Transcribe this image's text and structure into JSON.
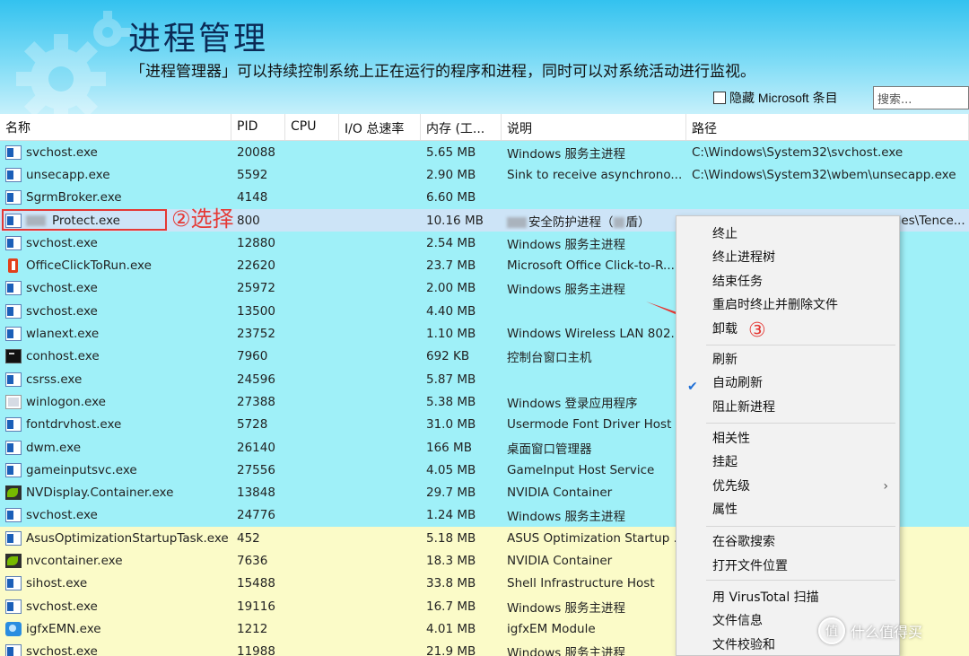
{
  "header": {
    "title": "进程管理",
    "subtitle": "「进程管理器」可以持续控制系统上正在运行的程序和进程，同时可以对系统活动进行监视。",
    "hide_ms_label": "隐藏 Microsoft 条目",
    "search_placeholder": "搜索..."
  },
  "columns": [
    "名称",
    "PID",
    "CPU",
    "I/O 总速率",
    "内存 (工...",
    "说明",
    "路径"
  ],
  "rows": [
    {
      "name": "svchost.exe",
      "pid": "20088",
      "mem": "5.65 MB",
      "desc": "Windows 服务主进程",
      "path": "C:\\Windows\\System32\\svchost.exe",
      "icon": "exe"
    },
    {
      "name": "unsecapp.exe",
      "pid": "5592",
      "mem": "2.90 MB",
      "desc": "Sink to receive asynchrono...",
      "path": "C:\\Windows\\System32\\wbem\\unsecapp.exe",
      "icon": "exe"
    },
    {
      "name": "SgrmBroker.exe",
      "pid": "4148",
      "mem": "6.60 MB",
      "desc": "",
      "path": "",
      "icon": "exe"
    },
    {
      "name": "Protect.exe",
      "pid": "800",
      "mem": "10.16 MB",
      "desc": "安全防护进程（",
      "desc_tail": "盾）",
      "path": "C:\\Program Files (x86)\\Common Files\\Tence...",
      "icon": "exe"
    },
    {
      "name": "svchost.exe",
      "pid": "12880",
      "mem": "2.54 MB",
      "desc": "Windows 服务主进程",
      "path": "",
      "icon": "exe"
    },
    {
      "name": "OfficeClickToRun.exe",
      "pid": "22620",
      "mem": "23.7 MB",
      "desc": "Microsoft Office Click-to-R...",
      "path": "rosoft s...",
      "icon": "office"
    },
    {
      "name": "svchost.exe",
      "pid": "25972",
      "mem": "2.00 MB",
      "desc": "Windows 服务主进程",
      "path": "",
      "icon": "exe"
    },
    {
      "name": "svchost.exe",
      "pid": "13500",
      "mem": "4.40 MB",
      "desc": "",
      "path": "",
      "icon": "exe"
    },
    {
      "name": "wlanext.exe",
      "pid": "23752",
      "mem": "1.10 MB",
      "desc": "Windows Wireless LAN 802....",
      "path": "",
      "icon": "exe"
    },
    {
      "name": "conhost.exe",
      "pid": "7960",
      "mem": "692 KB",
      "desc": "控制台窗口主机",
      "path": "",
      "icon": "console"
    },
    {
      "name": "csrss.exe",
      "pid": "24596",
      "mem": "5.87 MB",
      "desc": "",
      "path": "",
      "icon": "exe"
    },
    {
      "name": "winlogon.exe",
      "pid": "27388",
      "mem": "5.38 MB",
      "desc": "Windows 登录应用程序",
      "path": "e",
      "icon": "logon"
    },
    {
      "name": "fontdrvhost.exe",
      "pid": "5728",
      "mem": "31.0 MB",
      "desc": "Usermode Font Driver Host",
      "path": "exe",
      "icon": "exe"
    },
    {
      "name": "dwm.exe",
      "pid": "26140",
      "mem": "166 MB",
      "desc": "桌面窗口管理器",
      "path": "",
      "icon": "exe"
    },
    {
      "name": "gameinputsvc.exe",
      "pid": "27556",
      "mem": "4.05 MB",
      "desc": "GameInput Host Service",
      "path": "meInput...",
      "icon": "exe"
    },
    {
      "name": "NVDisplay.Container.exe",
      "pid": "13848",
      "mem": "29.7 MB",
      "desc": "NVIDIA Container",
      "path": "ileRepo...",
      "icon": "nvidia"
    },
    {
      "name": "svchost.exe",
      "pid": "24776",
      "mem": "1.24 MB",
      "desc": "Windows 服务主进程",
      "path": "",
      "icon": "exe"
    },
    {
      "name": "AsusOptimizationStartupTask.exe",
      "pid": "452",
      "mem": "5.18 MB",
      "desc": "ASUS Optimization Startup ...",
      "path": "ileRepo...",
      "icon": "exe"
    },
    {
      "name": "nvcontainer.exe",
      "pid": "7636",
      "mem": "18.3 MB",
      "desc": "NVIDIA Container",
      "path": "n\\NvCo...",
      "icon": "nvidia"
    },
    {
      "name": "sihost.exe",
      "pid": "15488",
      "mem": "33.8 MB",
      "desc": "Shell Infrastructure Host",
      "path": "",
      "icon": "exe"
    },
    {
      "name": "svchost.exe",
      "pid": "19116",
      "mem": "16.7 MB",
      "desc": "Windows 服务主进程",
      "path": "",
      "icon": "exe"
    },
    {
      "name": "igfxEMN.exe",
      "pid": "1212",
      "mem": "4.01 MB",
      "desc": "igfxEM Module",
      "path": "",
      "icon": "igfx"
    },
    {
      "name": "svchost.exe",
      "pid": "11988",
      "mem": "21.9 MB",
      "desc": "Windows 服务主进程",
      "path": "",
      "icon": "exe"
    }
  ],
  "row_colors": [
    "cyan",
    "cyan",
    "cyan",
    "selected",
    "cyan",
    "cyan",
    "cyan",
    "cyan",
    "cyan",
    "cyan",
    "cyan",
    "cyan",
    "cyan",
    "cyan",
    "cyan",
    "cyan",
    "cyan",
    "yellow",
    "yellow",
    "yellow",
    "yellow",
    "yellow",
    "yellow"
  ],
  "annotations": {
    "step2": "②选择",
    "step3": "③"
  },
  "context_menu": {
    "items": [
      {
        "label": "终止"
      },
      {
        "label": "终止进程树"
      },
      {
        "label": "结束任务"
      },
      {
        "label": "重启时终止并删除文件"
      },
      {
        "label": "卸载"
      },
      {
        "label": "刷新"
      },
      {
        "label": "自动刷新",
        "checked": true
      },
      {
        "label": "阻止新进程"
      },
      {
        "label": "相关性"
      },
      {
        "label": "挂起"
      },
      {
        "label": "优先级",
        "submenu": true
      },
      {
        "label": "属性"
      },
      {
        "label": "在谷歌搜索"
      },
      {
        "label": "打开文件位置"
      },
      {
        "label": "用 VirusTotal 扫描"
      },
      {
        "label": "文件信息"
      },
      {
        "label": "文件校验和"
      }
    ]
  },
  "watermark": {
    "logo": "值",
    "text": "什么值得买"
  },
  "colors": {
    "cyan_row": "#9ff0f8",
    "yellow_row": "#fbfbc8",
    "selected_row": "#cde4f7",
    "annotation_red": "#e53935"
  }
}
